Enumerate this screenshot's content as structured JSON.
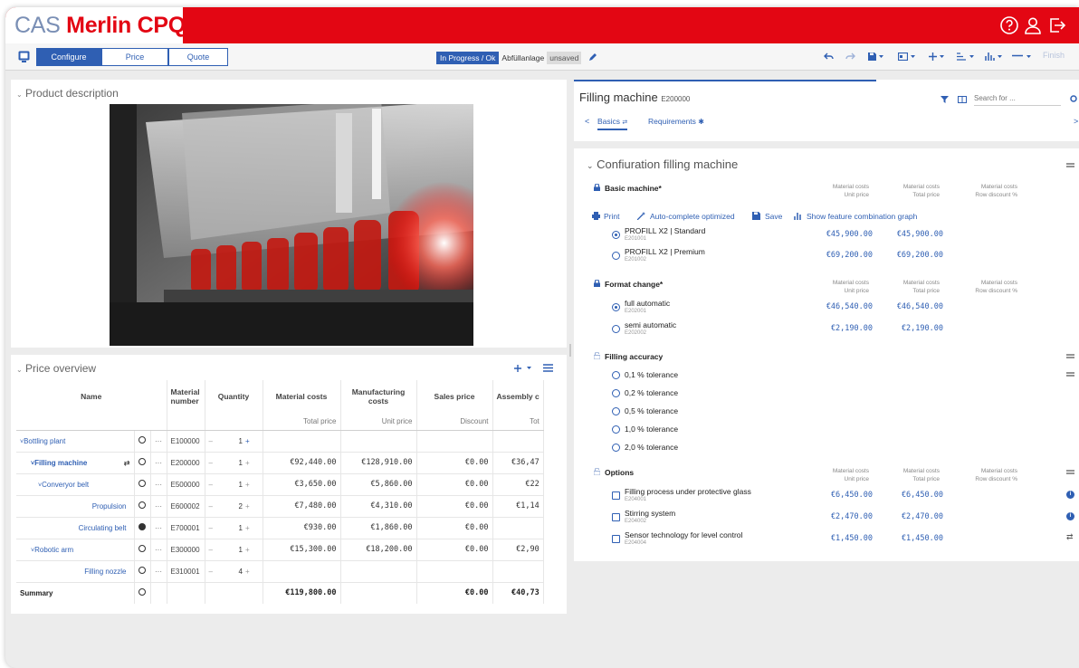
{
  "app": {
    "brand_prefix": "CAS",
    "brand_name": "Merlin CPQ"
  },
  "tabs": [
    {
      "label": "Configure",
      "active": true
    },
    {
      "label": "Price",
      "active": false
    },
    {
      "label": "Quote",
      "active": false
    }
  ],
  "status": {
    "badge": "In Progress / Ok",
    "project": "Abfüllanlage",
    "saved_state": "unsaved"
  },
  "toolbar": {
    "finish_label": "Finish"
  },
  "product_description": {
    "title": "Product description"
  },
  "price_overview": {
    "title": "Price overview",
    "columns": [
      {
        "label": "Name",
        "sub": ""
      },
      {
        "label": "Material number",
        "sub": ""
      },
      {
        "label": "Quantity",
        "sub": ""
      },
      {
        "label": "Material costs",
        "sub": "Total price"
      },
      {
        "label": "Manufacturing costs",
        "sub": "Unit price"
      },
      {
        "label": "Sales price",
        "sub": "Discount"
      },
      {
        "label": "Assembly c",
        "sub": "Tot"
      }
    ],
    "rows": [
      {
        "name": "Bottling plant",
        "mat": "E100000",
        "qty": "1",
        "mc": "",
        "mf": "",
        "sp": "",
        "as": ""
      },
      {
        "name": "Filling machine",
        "mat": "E200000",
        "qty": "1",
        "mc": "€92,440.00",
        "mf": "€128,910.00",
        "sp": "€0.00",
        "as": "€36,47"
      },
      {
        "name": "Converyor belt",
        "mat": "E500000",
        "qty": "1",
        "mc": "€3,650.00",
        "mf": "€5,860.00",
        "sp": "€0.00",
        "as": "€22"
      },
      {
        "name": "Propulsion",
        "mat": "E600002",
        "qty": "2",
        "mc": "€7,480.00",
        "mf": "€4,310.00",
        "sp": "€0.00",
        "as": "€1,14"
      },
      {
        "name": "Circulating belt",
        "mat": "E700001",
        "qty": "1",
        "mc": "€930.00",
        "mf": "€1,860.00",
        "sp": "€0.00",
        "as": ""
      },
      {
        "name": "Robotic arm",
        "mat": "E300000",
        "qty": "1",
        "mc": "€15,300.00",
        "mf": "€18,200.00",
        "sp": "€0.00",
        "as": "€2,90"
      },
      {
        "name": "Filling nozzle",
        "mat": "E310001",
        "qty": "4",
        "mc": "",
        "mf": "",
        "sp": "",
        "as": ""
      }
    ],
    "summary": {
      "label": "Summary",
      "mc": "€119,800.00",
      "sp": "€0.00",
      "as": "€40,73"
    }
  },
  "config": {
    "title": "Filling machine",
    "code": "E200000",
    "search_placeholder": "Search for ...",
    "subtabs": [
      "Basics",
      "Requirements"
    ],
    "section_title": "Confiuration filling machine",
    "col_mc": "Material costs",
    "col_unit": "Unit price",
    "col_total": "Total price",
    "col_disc": "Row discount %",
    "actions": {
      "print": "Print",
      "auto": "Auto-complete optimized",
      "save": "Save",
      "graph": "Show feature combination graph"
    },
    "basic": {
      "label": "Basic machine*",
      "options": [
        {
          "label": "PROFILL X2 | Standard",
          "code": "E201001",
          "unit": "€45,900.00",
          "total": "€45,900.00",
          "selected": true
        },
        {
          "label": "PROFILL X2 | Premium",
          "code": "E201002",
          "unit": "€69,200.00",
          "total": "€69,200.00",
          "selected": false
        }
      ]
    },
    "format": {
      "label": "Format change*",
      "options": [
        {
          "label": "full automatic",
          "code": "E202001",
          "unit": "€46,540.00",
          "total": "€46,540.00",
          "selected": true
        },
        {
          "label": "semi automatic",
          "code": "E202002",
          "unit": "€2,190.00",
          "total": "€2,190.00",
          "selected": false
        }
      ]
    },
    "accuracy": {
      "label": "Filling accuracy",
      "options": [
        "0,1 % tolerance",
        "0,2 % tolerance",
        "0,5 % tolerance",
        "1,0 % tolerance",
        "2,0 % tolerance"
      ]
    },
    "options": {
      "label": "Options",
      "items": [
        {
          "label": "Filling process under protective glass",
          "code": "E204001",
          "unit": "€6,450.00",
          "total": "€6,450.00"
        },
        {
          "label": "Stirring system",
          "code": "E204002",
          "unit": "€2,470.00",
          "total": "€2,470.00"
        },
        {
          "label": "Sensor technology for level control",
          "code": "E204004",
          "unit": "€1,450.00",
          "total": "€1,450.00"
        }
      ]
    }
  },
  "colors": {
    "brand_red": "#e30613",
    "accent_blue": "#2f5fb3"
  }
}
